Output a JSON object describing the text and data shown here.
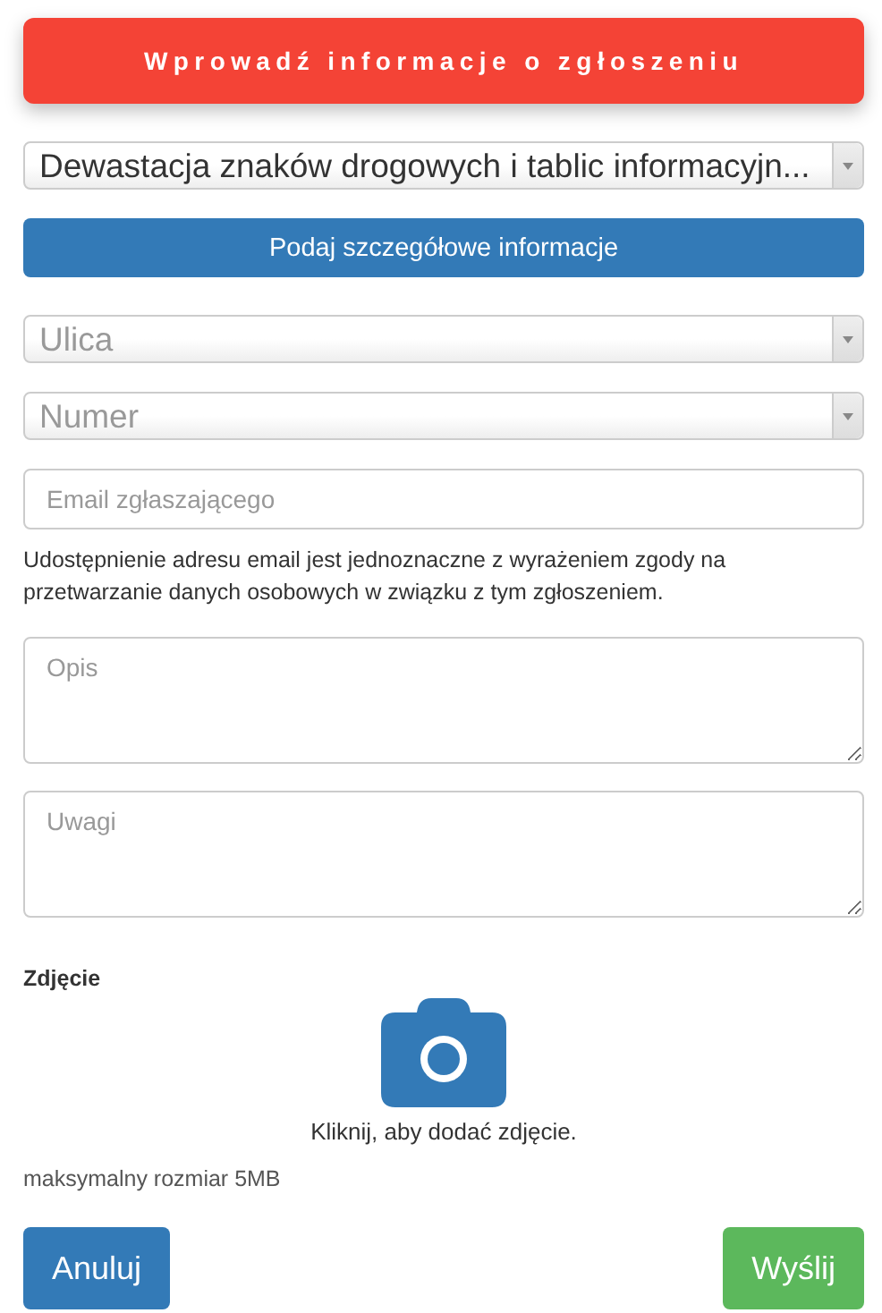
{
  "header": {
    "title": "Wprowadź informacje o zgłoszeniu"
  },
  "category_select": {
    "value": "Dewastacja znaków drogowych i tablic informacyjn..."
  },
  "details_button": {
    "label": "Podaj szczegółowe informacje"
  },
  "location_selects": [
    {
      "placeholder": "Ulica"
    },
    {
      "placeholder": "Numer"
    }
  ],
  "email_field": {
    "placeholder": "Email zgłaszającego"
  },
  "email_notice": "Udostępnienie adresu email jest jednoznaczne z wyrażeniem zgody na przetwarzanie danych osobowych w związku z tym zgłoszeniem.",
  "text_areas": [
    {
      "placeholder": "Opis"
    },
    {
      "placeholder": "Uwagi"
    }
  ],
  "photo": {
    "label": "Zdjęcie",
    "hint": "Kliknij, aby dodać zdjęcie.",
    "size_limit": "maksymalny rozmiar 5MB"
  },
  "actions": [
    {
      "label": "Anuluj",
      "kind": "cancel"
    },
    {
      "label": "Wyślij",
      "kind": "submit"
    }
  ]
}
